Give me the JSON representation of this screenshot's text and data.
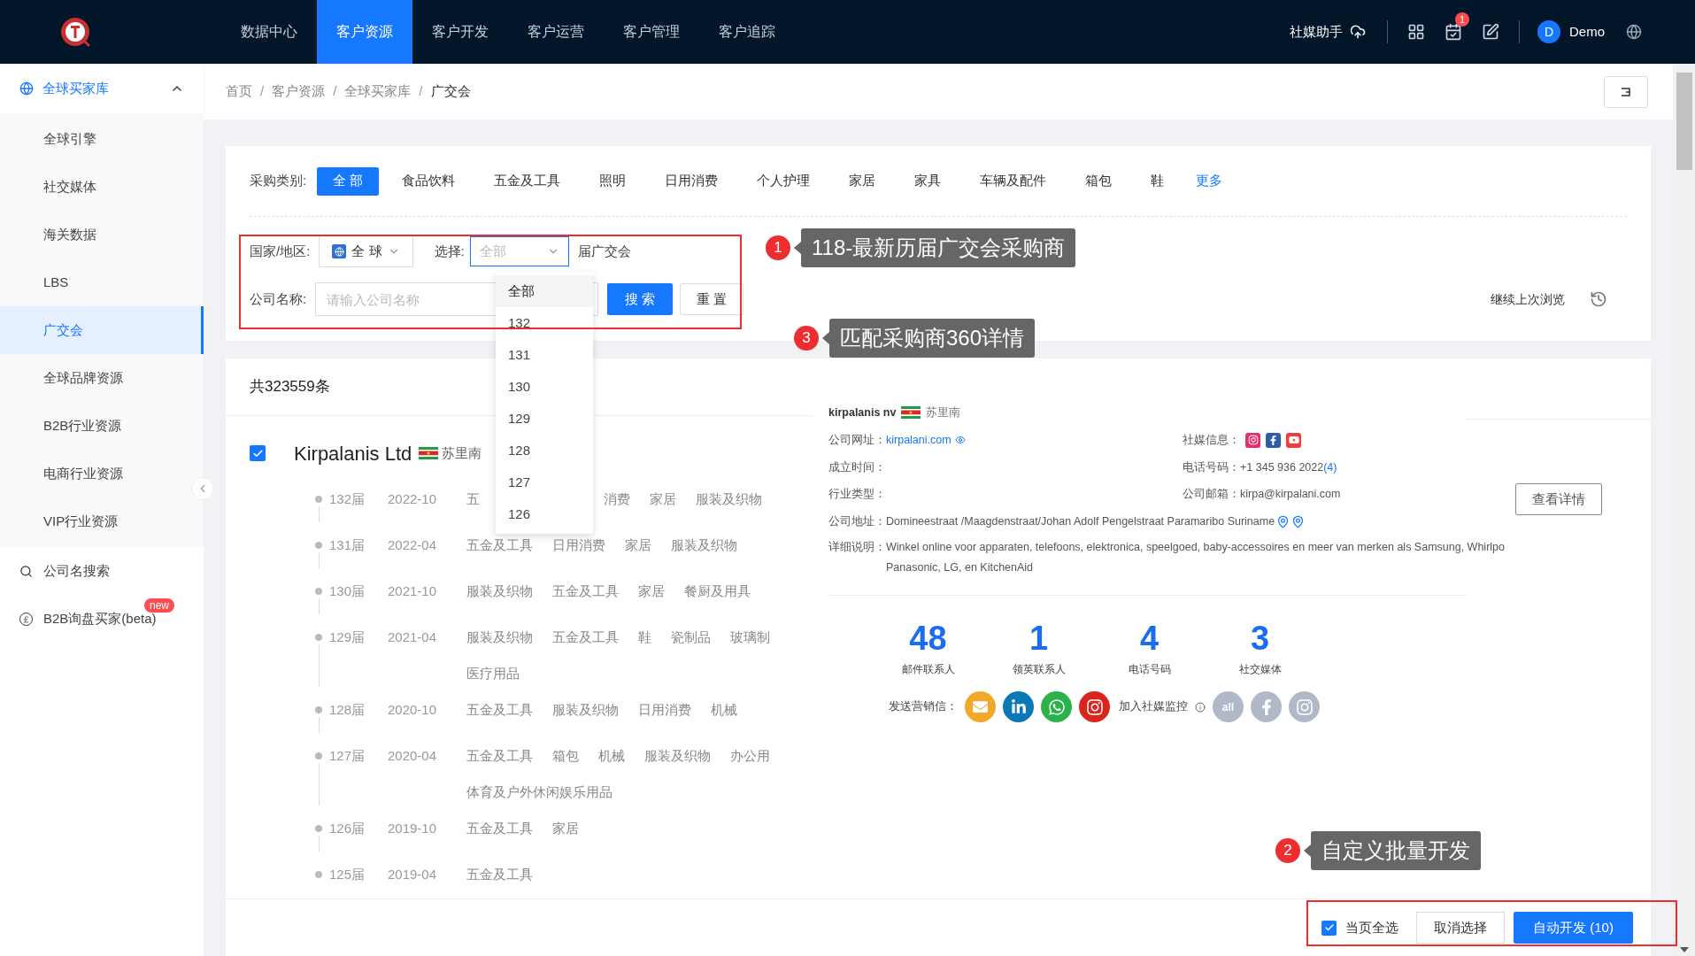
{
  "topbar": {
    "nav": [
      {
        "label": "数据中心",
        "selected": false
      },
      {
        "label": "客户资源",
        "selected": true
      },
      {
        "label": "客户开发",
        "selected": false
      },
      {
        "label": "客户运营",
        "selected": false
      },
      {
        "label": "客户管理",
        "selected": false
      },
      {
        "label": "客户追踪",
        "selected": false
      }
    ],
    "assistant": "社媒助手",
    "notification_count": "1",
    "user_initial": "D",
    "user_name": "Demo"
  },
  "sidebar": {
    "group": {
      "label": "全球买家库",
      "expanded": true,
      "items": [
        {
          "label": "全球引擎",
          "selected": false
        },
        {
          "label": "社交媒体",
          "selected": false
        },
        {
          "label": "海关数据",
          "selected": false
        },
        {
          "label": "LBS",
          "selected": false
        },
        {
          "label": "广交会",
          "selected": true
        },
        {
          "label": "全球品牌资源",
          "selected": false
        },
        {
          "label": "B2B行业资源",
          "selected": false
        },
        {
          "label": "电商行业资源",
          "selected": false
        },
        {
          "label": "VIP行业资源",
          "selected": false
        }
      ]
    },
    "items": [
      {
        "label": "公司名搜索",
        "kind": "search"
      },
      {
        "label": "B2B询盘买家(beta)",
        "kind": "pound",
        "badge": "new"
      }
    ]
  },
  "breadcrumb": {
    "items": [
      "首页",
      "客户资源",
      "全球买家库",
      "广交会"
    ],
    "separator": "/"
  },
  "filters": {
    "category_label": "采购类别:",
    "categories": [
      {
        "label": "全 部",
        "selected": true
      },
      {
        "label": "食品饮料",
        "selected": false
      },
      {
        "label": "五金及工具",
        "selected": false
      },
      {
        "label": "照明",
        "selected": false
      },
      {
        "label": "日用消费",
        "selected": false
      },
      {
        "label": "个人护理",
        "selected": false
      },
      {
        "label": "家居",
        "selected": false
      },
      {
        "label": "家具",
        "selected": false
      },
      {
        "label": "车辆及配件",
        "selected": false
      },
      {
        "label": "箱包",
        "selected": false
      },
      {
        "label": "鞋",
        "selected": false
      }
    ],
    "more": "更多",
    "country_label": "国家/地区:",
    "country_value": "全 球",
    "select_label": "选择:",
    "select_placeholder": "全部",
    "select_suffix": "届广交会",
    "company_label": "公司名称:",
    "company_placeholder": "请输入公司名称",
    "search_button": "搜 索",
    "reset_button": "重 置",
    "resume": "继续上次浏览"
  },
  "dropdown": {
    "open": true,
    "options": [
      {
        "label": "全部",
        "selected": true
      },
      {
        "label": "132",
        "selected": false
      },
      {
        "label": "131",
        "selected": false
      },
      {
        "label": "130",
        "selected": false
      },
      {
        "label": "129",
        "selected": false
      },
      {
        "label": "128",
        "selected": false
      },
      {
        "label": "127",
        "selected": false
      },
      {
        "label": "126",
        "selected": false
      }
    ]
  },
  "results": {
    "total": "共323559条",
    "company": {
      "name": "Kirpalanis Ltd",
      "checked": true,
      "country": "苏里南",
      "sessions": [
        {
          "session": "132届",
          "date": "2022-10",
          "lines": [
            [
              "五",
              "消费",
              "家居",
              "服装及织物"
            ]
          ]
        },
        {
          "session": "131届",
          "date": "2022-04",
          "lines": [
            [
              "五金及工具",
              "日用消费",
              "家居",
              "服装及织物"
            ]
          ]
        },
        {
          "session": "130届",
          "date": "2021-10",
          "lines": [
            [
              "服装及织物",
              "五金及工具",
              "家居",
              "餐厨及用具"
            ]
          ]
        },
        {
          "session": "129届",
          "date": "2021-04",
          "lines": [
            [
              "服装及织物",
              "五金及工具",
              "鞋",
              "瓷制品",
              "玻璃制"
            ],
            [
              "医疗用品"
            ]
          ]
        },
        {
          "session": "128届",
          "date": "2020-10",
          "lines": [
            [
              "五金及工具",
              "服装及织物",
              "日用消费",
              "机械"
            ]
          ]
        },
        {
          "session": "127届",
          "date": "2020-04",
          "lines": [
            [
              "五金及工具",
              "箱包",
              "机械",
              "服装及织物",
              "办公用"
            ],
            [
              "体育及户外休闲娱乐用品"
            ]
          ]
        },
        {
          "session": "126届",
          "date": "2019-10",
          "lines": [
            [
              "五金及工具",
              "家居"
            ]
          ]
        },
        {
          "session": "125届",
          "date": "2019-04",
          "lines": [
            [
              "五金及工具"
            ]
          ]
        }
      ]
    },
    "detail": {
      "name": "kirpalanis nv",
      "country": "苏里南",
      "website_label": "公司网址：",
      "website": "kirpalani.com",
      "social_label": "社媒信息：",
      "founded_label": "成立时间：",
      "phone_label": "电话号码：",
      "phone": "+1 345 936 2022",
      "phone_count": "(4)",
      "industry_label": "行业类型：",
      "email_label": "公司邮箱：",
      "email": "kirpa@kirpalani.com",
      "address_label": "公司地址：",
      "address": "Domineestraat /Maagdenstraat/Johan Adolf Pengelstraat Paramaribo Suriname",
      "description_label": "详细说明：",
      "description_lines": [
        "Winkel online voor apparaten, telefoons, elektronica, speelgoed, baby-accessoires en meer van merken als Samsung, Whirlpo",
        "Panasonic, LG, en KitchenAid"
      ],
      "stats": [
        {
          "value": "48",
          "label": "邮件联系人"
        },
        {
          "value": "1",
          "label": "领英联系人"
        },
        {
          "value": "4",
          "label": "电话号码"
        },
        {
          "value": "3",
          "label": "社交媒体"
        }
      ],
      "marketing_label": "发送营销信：",
      "monitor_label": "加入社媒监控",
      "monitor_all": "all",
      "view_button": "查看详情"
    }
  },
  "bottom_bar": {
    "select_all": {
      "label": "当页全选",
      "checked": true
    },
    "cancel": "取消选择",
    "auto": "自动开发 (10)"
  },
  "annotations": [
    {
      "number": "1",
      "text": "118-最新历届广交会采购商"
    },
    {
      "number": "3",
      "text": "匹配采购商360详情"
    },
    {
      "number": "2",
      "text": "自定义批量开发"
    }
  ]
}
